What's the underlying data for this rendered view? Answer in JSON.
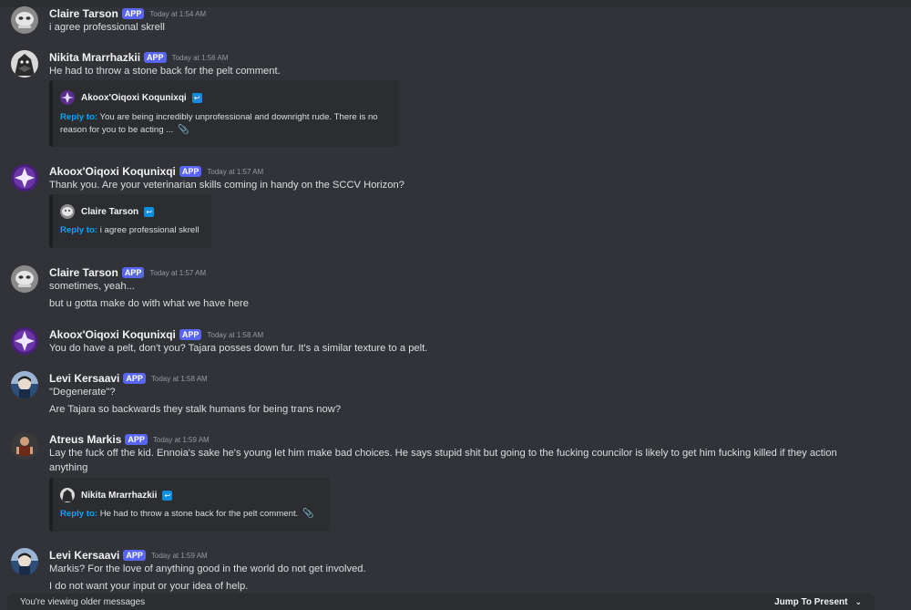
{
  "app_badge": "APP",
  "messages": [
    {
      "author": "Claire Tarson",
      "time": "Today at 1:54 AM",
      "lines": [
        "i agree professional skrell"
      ]
    },
    {
      "author": "Nikita Mrarrhazkii",
      "time": "Today at 1:56 AM",
      "lines": [
        "He had to throw a stone back for the pelt comment."
      ],
      "reply": {
        "author": "Akoox'Oiqoxi Koqunixqi",
        "label": "Reply to:",
        "text_line1": "You are being incredibly unprofessional and downright rude. There is no",
        "text_line2": "reason for you to be acting ..."
      }
    },
    {
      "author": "Akoox'Oiqoxi Koqunixqi",
      "time": "Today at 1:57 AM",
      "lines": [
        "Thank you. Are your veterinarian skills coming in handy on the SCCV Horizon?"
      ],
      "reply": {
        "author": "Claire Tarson",
        "label": "Reply to:",
        "text_line1": "i agree professional skrell"
      }
    },
    {
      "author": "Claire Tarson",
      "time": "Today at 1:57 AM",
      "lines": [
        "sometimes, yeah...",
        "but u gotta make do with what we have here"
      ]
    },
    {
      "author": "Akoox'Oiqoxi Koqunixqi",
      "time": "Today at 1:58 AM",
      "lines": [
        "You do have a pelt, don't you? Tajara posses down fur. It's a similar texture to a pelt."
      ]
    },
    {
      "author": "Levi Kersaavi",
      "time": "Today at 1:58 AM",
      "lines": [
        "\"Degenerate\"?",
        "Are Tajara so backwards they stalk humans for being trans now?"
      ]
    },
    {
      "author": "Atreus Markis",
      "time": "Today at 1:59 AM",
      "lines": [
        "Lay the fuck off the kid. Ennoia's sake he's young let him make bad choices. He says stupid shit but going to the fucking councilor is likely to get him fucking killed if they action anything"
      ],
      "reply": {
        "author": "Nikita Mrarrhazkii",
        "label": "Reply to:",
        "text_line1": "He had to throw a stone back for the pelt comment."
      }
    },
    {
      "author": "Levi Kersaavi",
      "time": "Today at 1:59 AM",
      "lines": [
        "Markis? For the love of anything good in the world do not get involved.",
        "I do not want your input or your idea of help."
      ]
    }
  ],
  "bottom_bar": {
    "status": "You're viewing older messages",
    "jump_label": "Jump To Present"
  },
  "colors": {
    "background": "#313338",
    "embed_bg": "#2b2d31",
    "badge": "#5865f2",
    "reply_link": "#00a8fc"
  },
  "icons": {
    "reply_marker": "reply-arrow-icon",
    "attachment": "paperclip-icon",
    "jump": "chevron-down-icon"
  }
}
